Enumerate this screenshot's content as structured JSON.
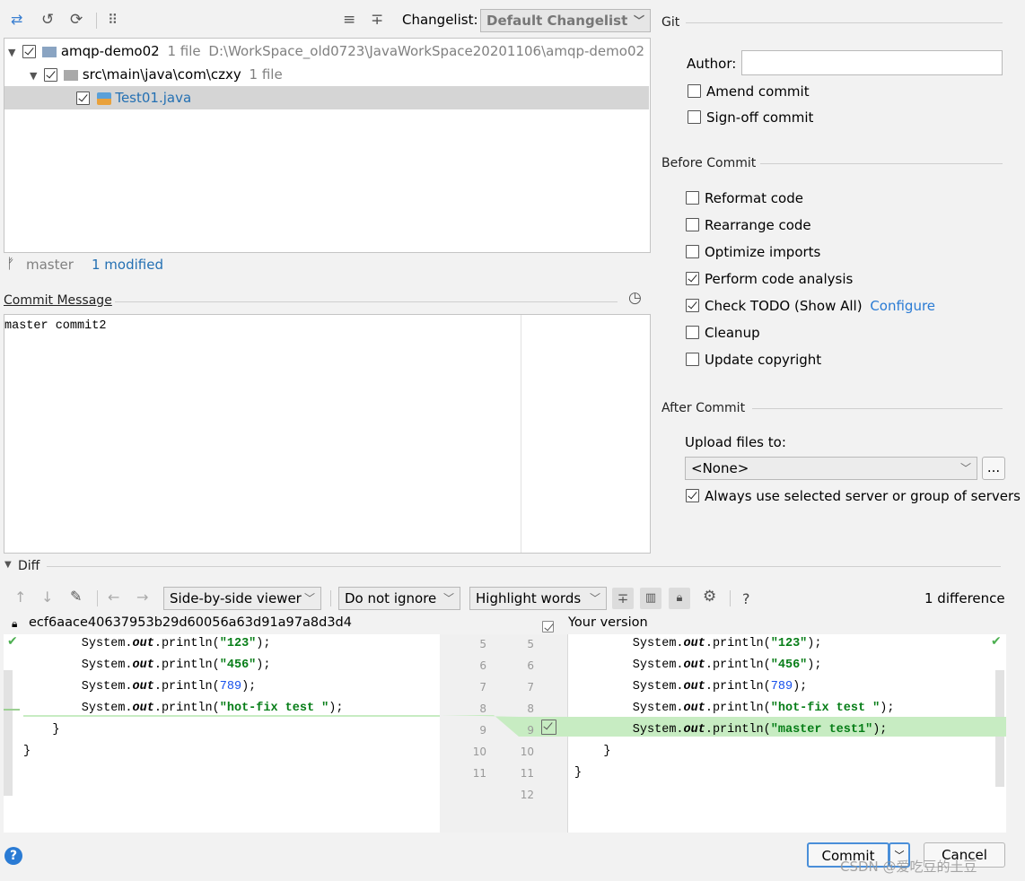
{
  "toolbar": {
    "changelist_label": "Changelist:",
    "changelist_value": "Default Changelist"
  },
  "tree": {
    "root_name": "amqp-demo02",
    "root_count": "1 file",
    "root_path": "D:\\WorkSpace_old0723\\JavaWorkSpace20201106\\amqp-demo02",
    "dir_name": "src\\main\\java\\com\\czxy",
    "dir_count": "1 file",
    "file_name": "Test01.java"
  },
  "status": {
    "branch": "master",
    "modified": "1 modified"
  },
  "commit_message": {
    "title": "Commit Message",
    "text": "master commit2"
  },
  "git": {
    "title": "Git",
    "author_label": "Author:",
    "author_value": "",
    "amend": {
      "label": "Amend commit",
      "checked": false
    },
    "signoff": {
      "label": "Sign-off commit",
      "checked": false
    }
  },
  "before_commit": {
    "title": "Before Commit",
    "items": [
      {
        "label": "Reformat code",
        "checked": false
      },
      {
        "label": "Rearrange code",
        "checked": false
      },
      {
        "label": "Optimize imports",
        "checked": false
      },
      {
        "label": "Perform code analysis",
        "checked": true
      },
      {
        "label": "Check TODO (Show All)",
        "checked": true,
        "link": "Configure"
      },
      {
        "label": "Cleanup",
        "checked": false
      },
      {
        "label": "Update copyright",
        "checked": false
      }
    ]
  },
  "after_commit": {
    "title": "After Commit",
    "upload_label": "Upload files to:",
    "upload_value": "<None>",
    "more_button": "...",
    "always_use": {
      "label": "Always use selected server or group of servers",
      "checked": true
    }
  },
  "diff": {
    "title": "Diff",
    "viewer": "Side-by-side viewer",
    "ignore": "Do not ignore",
    "highlight": "Highlight words",
    "help": "?",
    "count": "1 difference",
    "left_title": "ecf6aace40637953b29d60056a63d91a97a8d3d4",
    "right_title": "Your version",
    "left_lines": [
      {
        "prefix": "        System.",
        "kw": "out",
        "mid": ".println(",
        "str": "\"123\"",
        "num": "",
        "end": ");"
      },
      {
        "prefix": "        System.",
        "kw": "out",
        "mid": ".println(",
        "str": "\"456\"",
        "num": "",
        "end": ");"
      },
      {
        "prefix": "        System.",
        "kw": "out",
        "mid": ".println(",
        "str": "",
        "num": "789",
        "end": ");"
      },
      {
        "prefix": "        System.",
        "kw": "out",
        "mid": ".println(",
        "str": "\"hot-fix test \"",
        "num": "",
        "end": ");"
      },
      {
        "prefix": "    }",
        "kw": "",
        "mid": "",
        "str": "",
        "num": "",
        "end": ""
      },
      {
        "prefix": "}",
        "kw": "",
        "mid": "",
        "str": "",
        "num": "",
        "end": ""
      }
    ],
    "right_lines": [
      {
        "prefix": "        System.",
        "kw": "out",
        "mid": ".println(",
        "str": "\"123\"",
        "num": "",
        "end": ");"
      },
      {
        "prefix": "        System.",
        "kw": "out",
        "mid": ".println(",
        "str": "\"456\"",
        "num": "",
        "end": ");"
      },
      {
        "prefix": "        System.",
        "kw": "out",
        "mid": ".println(",
        "str": "",
        "num": "789",
        "end": ");"
      },
      {
        "prefix": "        System.",
        "kw": "out",
        "mid": ".println(",
        "str": "\"hot-fix test \"",
        "num": "",
        "end": ");"
      },
      {
        "prefix": "        System.",
        "kw": "out",
        "mid": ".println(",
        "str": "\"master test1\"",
        "num": "",
        "end": ");"
      },
      {
        "prefix": "    }",
        "kw": "",
        "mid": "",
        "str": "",
        "num": "",
        "end": ""
      },
      {
        "prefix": "}",
        "kw": "",
        "mid": "",
        "str": "",
        "num": "",
        "end": ""
      }
    ],
    "left_numbers": [
      "5",
      "6",
      "7",
      "8",
      "9",
      "10",
      "11"
    ],
    "right_numbers": [
      "5",
      "6",
      "7",
      "8",
      "9",
      "10",
      "11",
      "12"
    ]
  },
  "footer": {
    "help": "?",
    "commit": "Commit",
    "cancel": "Cancel",
    "watermark": "CSDN @爱吃豆的土豆"
  },
  "colors": {
    "added_bg": "#c7ecc2",
    "accent": "#2a7bd4"
  }
}
